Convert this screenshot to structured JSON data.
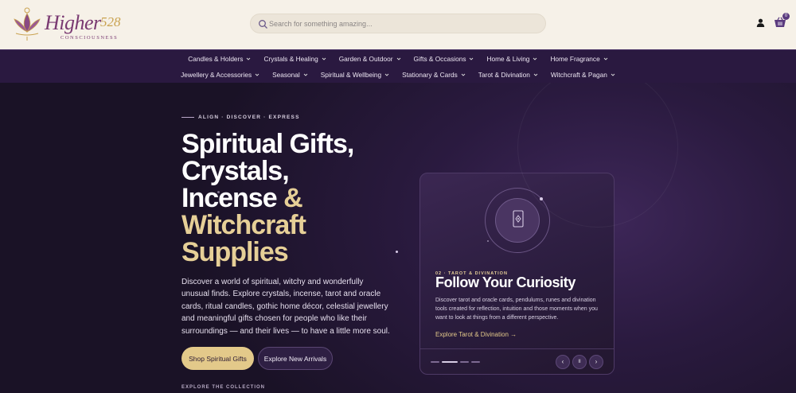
{
  "brand": {
    "name": "Higher",
    "number": "528",
    "tagline": "CONSCIOUSNESS"
  },
  "search": {
    "placeholder": "Search for something amazing..."
  },
  "header": {
    "cart_count": "0"
  },
  "nav": {
    "row1": [
      "Candles & Holders",
      "Crystals & Healing",
      "Garden & Outdoor",
      "Gifts & Occasions",
      "Home & Living",
      "Home Fragrance"
    ],
    "row2": [
      "Jewellery & Accessories",
      "Seasonal",
      "Spiritual & Wellbeing",
      "Stationary & Cards",
      "Tarot & Divination",
      "Witchcraft & Pagan"
    ]
  },
  "hero": {
    "eyebrow": "ALIGN · DISCOVER · EXPRESS",
    "title_line1": "Spiritual Gifts,",
    "title_line2": "Crystals,",
    "title_line3": "Incense",
    "title_amp": "&",
    "title_line4": "Witchcraft",
    "title_line5": "Supplies",
    "description": "Discover a world of spiritual, witchy and wonderfully unusual finds. Explore crystals, incense, tarot and oracle cards, ritual candles, gothic home décor, celestial jewellery and meaningful gifts chosen for people who like their surroundings — and their lives — to have a little more soul.",
    "primary_button": "Shop Spiritual Gifts",
    "secondary_button": "Explore New Arrivals",
    "explore_label": "EXPLORE THE COLLECTION"
  },
  "card": {
    "eyebrow": "02 · TAROT & DIVINATION",
    "title": "Follow Your Curiosity",
    "description": "Discover tarot and oracle cards, pendulums, runes and divination tools created for reflection, intuition and those moments when you want to look at things from a different perspective.",
    "link": "Explore Tarot & Divination →",
    "prev": "‹",
    "pause": "II",
    "next": "›"
  },
  "colors": {
    "brand_purple": "#7a3a72",
    "nav_bg": "#2a1940",
    "gold": "#e3c98a",
    "hero_bg": "#1a1226"
  }
}
